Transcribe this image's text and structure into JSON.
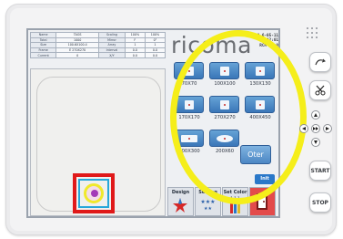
{
  "info_table": {
    "rows": [
      [
        "Name",
        "TAGS",
        "Scaling",
        "100%",
        "100%"
      ],
      [
        "Total",
        "1000",
        "Mirror",
        "F",
        "0°"
      ],
      [
        "Size",
        "100.6X100.4",
        "Array",
        "1",
        "1"
      ],
      [
        "Frame",
        "E 270X270",
        "Interval",
        "0.0",
        "0.0"
      ],
      [
        "Current",
        "0",
        "X/Y",
        "0.0",
        "0.0"
      ]
    ]
  },
  "brand": {
    "logo": "ricoma"
  },
  "version": {
    "line1": "20-6-05-11",
    "line2": "14:42:01",
    "line3": "RCM V2.0"
  },
  "hoops": [
    {
      "label": "70X70",
      "shape": "square"
    },
    {
      "label": "100X100",
      "shape": "square"
    },
    {
      "label": "130X130",
      "shape": "square"
    },
    {
      "label": "170X170",
      "shape": "square"
    },
    {
      "label": "270X270",
      "shape": "square"
    },
    {
      "label": "400X450",
      "shape": "square"
    },
    {
      "label": "500X300",
      "shape": "wide"
    },
    {
      "label": "200X60",
      "shape": "cap"
    }
  ],
  "other_button": "Oter",
  "ok_button": "Init",
  "tabs": [
    {
      "label": "Design",
      "sub": ""
    },
    {
      "label": "Setting",
      "sub": ""
    },
    {
      "label": "Set Color",
      "sub": "1-1 1"
    },
    {
      "label": "",
      "sub": ""
    }
  ],
  "hardware": {
    "start": "START",
    "stop": "STOP"
  },
  "colors": {
    "annotation": "#f5ee1a",
    "hoop_button": "#3a76b8",
    "design_border": "#e01919"
  }
}
